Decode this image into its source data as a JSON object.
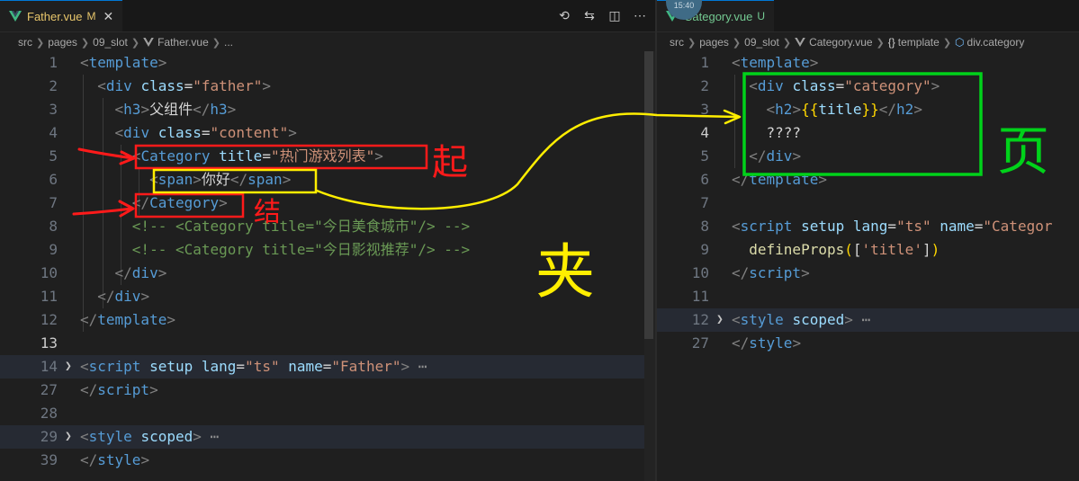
{
  "left": {
    "tab": {
      "name": "Father.vue",
      "status": "M",
      "close": "✕"
    },
    "actions": [
      "⟲",
      "⇆",
      "◫",
      "⋯"
    ],
    "breadcrumb": {
      "p1": "src",
      "p2": "pages",
      "p3": "09_slot",
      "file": "Father.vue",
      "more": "..."
    },
    "lines": [
      {
        "ln": "1"
      },
      {
        "ln": "2"
      },
      {
        "ln": "3"
      },
      {
        "ln": "4"
      },
      {
        "ln": "5"
      },
      {
        "ln": "6"
      },
      {
        "ln": "7"
      },
      {
        "ln": "8"
      },
      {
        "ln": "9"
      },
      {
        "ln": "10"
      },
      {
        "ln": "11"
      },
      {
        "ln": "12"
      },
      {
        "ln": "13"
      },
      {
        "ln": "14"
      },
      {
        "ln": "27"
      },
      {
        "ln": "28"
      },
      {
        "ln": "29"
      },
      {
        "ln": "39"
      }
    ],
    "code": {
      "template_open": "template",
      "div": "div",
      "class_attr": "class",
      "father": "\"father\"",
      "h3": "h3",
      "h3_text": "父组件",
      "content": "\"content\"",
      "category": "Category",
      "title_attr": "title",
      "title_val": "\"热门游戏列表\"",
      "span": "span",
      "span_text": "你好",
      "comment1": "<!-- <Category title=\"今日美食城市\"/> -->",
      "comment2": "<!-- <Category title=\"今日影视推荐\"/> -->",
      "script": "script",
      "setup": "setup",
      "lang": "lang",
      "ts": "\"ts\"",
      "name_attr": "name",
      "father_name": "\"Father\"",
      "ellipsis": "⋯",
      "style": "style",
      "scoped": "scoped"
    }
  },
  "right": {
    "avatar": "15:40",
    "tab": {
      "name": "Category.vue",
      "status": "U",
      "close": ""
    },
    "breadcrumb": {
      "p1": "src",
      "p2": "pages",
      "p3": "09_slot",
      "file": "Category.vue",
      "sym1": "{}",
      "seg1": "template",
      "seg2": "div.category"
    },
    "lines": [
      {
        "ln": "1"
      },
      {
        "ln": "2"
      },
      {
        "ln": "3"
      },
      {
        "ln": "4"
      },
      {
        "ln": "5"
      },
      {
        "ln": "6"
      },
      {
        "ln": "7"
      },
      {
        "ln": "8"
      },
      {
        "ln": "9"
      },
      {
        "ln": "10"
      },
      {
        "ln": "11"
      },
      {
        "ln": "12"
      },
      {
        "ln": "27"
      }
    ],
    "code": {
      "template": "template",
      "div": "div",
      "class_attr": "class",
      "category_val": "\"category\"",
      "h2": "h2",
      "mustache_open": "{{",
      "title": "title",
      "mustache_close": "}}",
      "q": "????",
      "script": "script",
      "setup": "setup",
      "lang": "lang",
      "ts": "\"ts\"",
      "name_attr": "name",
      "name_val": "\"Categor",
      "define": "defineProps",
      "args": "'title'",
      "style": "style",
      "scoped": "scoped",
      "ellipsis": "⋯"
    }
  },
  "annotations": {
    "start_char": "起",
    "end_char": "结",
    "sandwich_char": "夹",
    "page_char": "页"
  },
  "colors": {
    "red": "#ff1a1a",
    "yellow": "#ffee00",
    "green": "#00d21a"
  }
}
